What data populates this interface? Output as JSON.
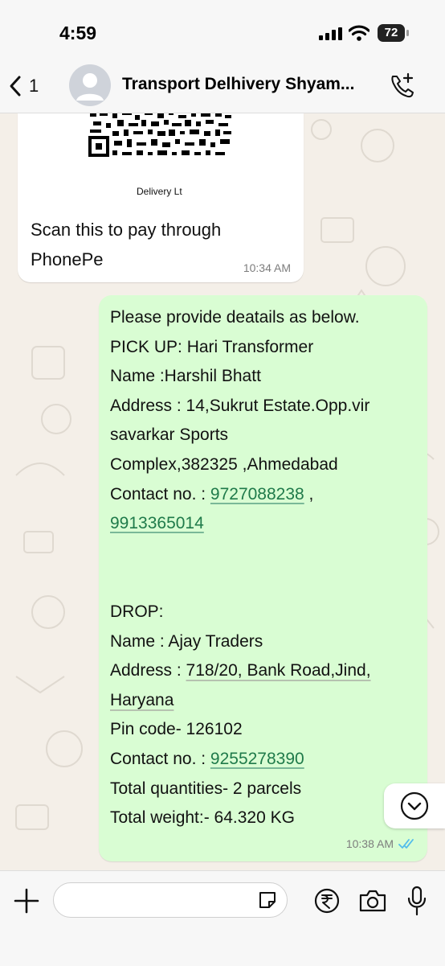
{
  "status_bar": {
    "time": "4:59",
    "battery": "72"
  },
  "header": {
    "back_count": "1",
    "title": "Transport Delhivery Shyam..."
  },
  "messages": {
    "incoming": {
      "qr_caption": "Delivery Lt",
      "text_line1": "Scan this to pay through",
      "text_line2": "PhonePe",
      "time": "10:34 AM"
    },
    "outgoing": {
      "line1": "Please provide deatails as below.",
      "line2": "PICK UP: Hari Transformer",
      "line3": "Name :Harshil Bhatt",
      "line4": "Address : 14,Sukrut Estate.Opp.vir",
      "line5": "savarkar Sports",
      "line6": "Complex,382325 ,Ahmedabad",
      "line7_prefix": "Contact no. : ",
      "phone1": "9727088238",
      "line7_suffix": " ,",
      "phone2": "9913365014",
      "drop_label": "DROP:",
      "drop_name": "Name : Ajay Traders",
      "drop_address_prefix": "Address : ",
      "drop_address_link": "718/20, Bank Road,Jind,",
      "drop_address_line2": "Haryana",
      "pin": "Pin code- 126102",
      "contact_prefix": "Contact no. : ",
      "phone3": "9255278390",
      "quantity": "Total quantities- 2 parcels",
      "weight": "Total weight:- 64.320 KG",
      "time": "10:38 AM"
    }
  },
  "icons": {
    "back": "chevron-left-icon",
    "call": "phone-plus-icon",
    "scroll": "chevron-down-circle-icon",
    "plus": "plus-icon",
    "sticker": "sticker-icon",
    "payment": "rupee-icon",
    "camera": "camera-icon",
    "mic": "microphone-icon"
  },
  "colors": {
    "outgoing_bubble": "#d9fdd3",
    "link": "#1f7a4a",
    "read_receipt": "#53bdeb"
  }
}
